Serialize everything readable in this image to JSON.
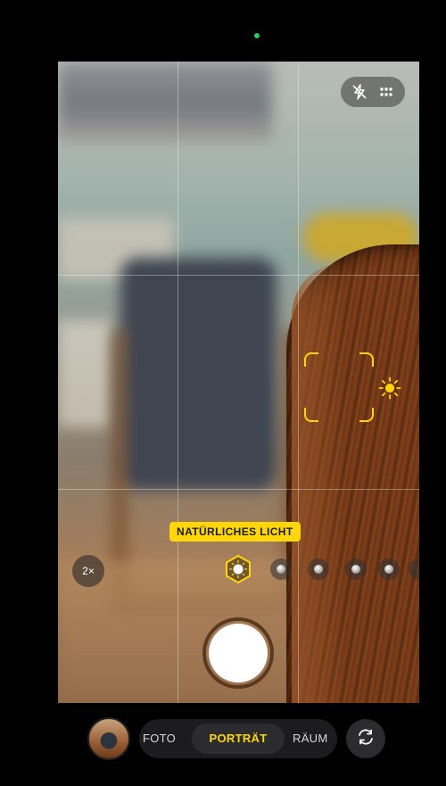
{
  "viewfinder": {
    "lighting_label": "NATÜRLICHES LICHT",
    "zoom_label": "2×"
  },
  "top_controls": {
    "icons": [
      "flash-off-icon",
      "controls-grid-icon"
    ]
  },
  "lighting_options": [
    "natural-light",
    "studio-light",
    "contour-light",
    "stage-light",
    "stage-light-mono",
    "high-key-mono"
  ],
  "modes": {
    "left": "FOTO",
    "selected": "PORTRÄT",
    "right": "RÄUM"
  },
  "colors": {
    "accent": "#ffd60a",
    "privacy_indicator": "#34c759"
  }
}
